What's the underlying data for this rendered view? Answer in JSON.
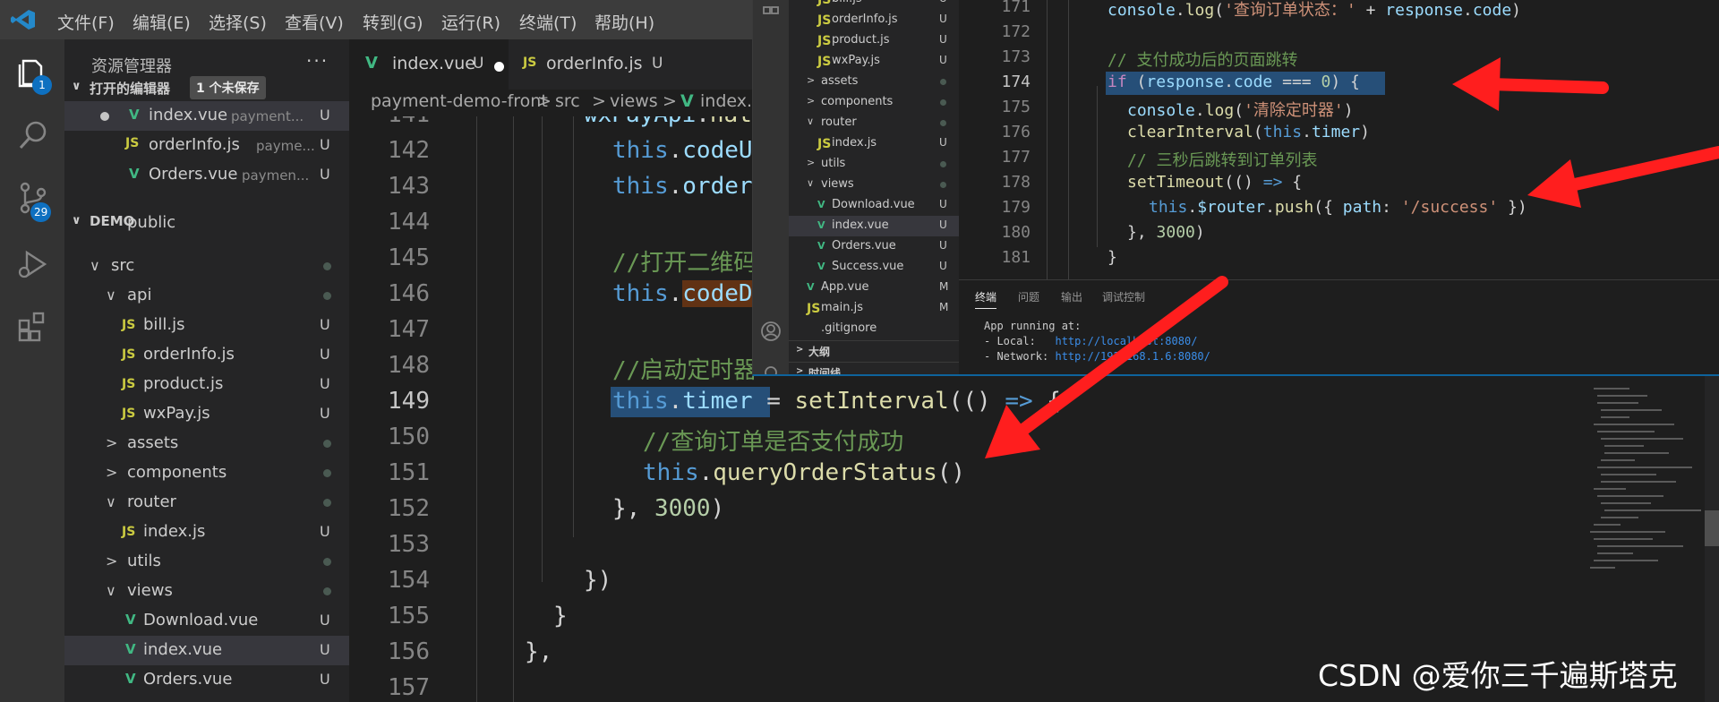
{
  "menubar": {
    "items": [
      "文件(F)",
      "编辑(E)",
      "选择(S)",
      "查看(V)",
      "转到(G)",
      "运行(R)",
      "终端(T)",
      "帮助(H)"
    ]
  },
  "activity": {
    "explorer_badge": "1",
    "scm_badge": "29"
  },
  "sidebar": {
    "title": "资源管理器",
    "more": "···",
    "open_editors": {
      "title": "打开的编辑器",
      "unsaved_badge": "1 个未保存",
      "items": [
        {
          "icon": "V",
          "name": "index.vue",
          "desc": "payment...",
          "status": "U"
        },
        {
          "icon": "JS",
          "name": "orderInfo.js",
          "desc": "payme...",
          "status": "U"
        },
        {
          "icon": "V",
          "name": "Orders.vue",
          "desc": "paymen...",
          "status": "U"
        }
      ]
    },
    "demo": {
      "title": "DEMO",
      "items": [
        {
          "chev": "",
          "icon": "",
          "name": "public",
          "status": ""
        },
        {
          "chev": "∨",
          "icon": "",
          "name": "src",
          "status": "dot"
        },
        {
          "chev": "∨",
          "icon": "",
          "name": "api",
          "status": "dot"
        },
        {
          "chev": "",
          "icon": "JS",
          "name": "bill.js",
          "status": "U"
        },
        {
          "chev": "",
          "icon": "JS",
          "name": "orderInfo.js",
          "status": "U"
        },
        {
          "chev": "",
          "icon": "JS",
          "name": "product.js",
          "status": "U"
        },
        {
          "chev": "",
          "icon": "JS",
          "name": "wxPay.js",
          "status": "U"
        },
        {
          "chev": ">",
          "icon": "",
          "name": "assets",
          "status": "dot"
        },
        {
          "chev": ">",
          "icon": "",
          "name": "components",
          "status": "dot"
        },
        {
          "chev": "∨",
          "icon": "",
          "name": "router",
          "status": "dot"
        },
        {
          "chev": "",
          "icon": "JS",
          "name": "index.js",
          "status": "U"
        },
        {
          "chev": ">",
          "icon": "",
          "name": "utils",
          "status": "dot"
        },
        {
          "chev": "∨",
          "icon": "",
          "name": "views",
          "status": "dot"
        },
        {
          "chev": "",
          "icon": "V",
          "name": "Download.vue",
          "status": "U"
        },
        {
          "chev": "",
          "icon": "V",
          "name": "index.vue",
          "status": "U"
        },
        {
          "chev": "",
          "icon": "V",
          "name": "Orders.vue",
          "status": "U"
        }
      ]
    }
  },
  "tabs": [
    {
      "icon": "V",
      "name": "index.vue",
      "status": "U"
    },
    {
      "icon": "JS",
      "name": "orderInfo.js",
      "status": "U"
    }
  ],
  "breadcrumb": [
    "payment-demo-front",
    ">",
    "src",
    ">",
    "views",
    ">",
    "index.vu"
  ],
  "editor": {
    "line_numbers": [
      "141",
      "142",
      "143",
      "144",
      "145",
      "146",
      "147",
      "148",
      "149",
      "150",
      "151",
      "152",
      "153",
      "154",
      "155",
      "156",
      "157"
    ],
    "current_line": "149"
  },
  "overlay": {
    "tree": [
      {
        "chev": "",
        "icon": "JS",
        "name": "bill.js",
        "status": "U"
      },
      {
        "chev": "",
        "icon": "JS",
        "name": "orderInfo.js",
        "status": "U"
      },
      {
        "chev": "",
        "icon": "JS",
        "name": "product.js",
        "status": "U"
      },
      {
        "chev": "",
        "icon": "JS",
        "name": "wxPay.js",
        "status": "U"
      },
      {
        "chev": ">",
        "icon": "",
        "name": "assets",
        "status": "dot"
      },
      {
        "chev": ">",
        "icon": "",
        "name": "components",
        "status": "dot"
      },
      {
        "chev": "∨",
        "icon": "",
        "name": "router",
        "status": "dot"
      },
      {
        "chev": "",
        "icon": "JS",
        "name": "index.js",
        "status": "U"
      },
      {
        "chev": ">",
        "icon": "",
        "name": "utils",
        "status": "dot"
      },
      {
        "chev": "∨",
        "icon": "",
        "name": "views",
        "status": "dot"
      },
      {
        "chev": "",
        "icon": "V",
        "name": "Download.vue",
        "status": "U"
      },
      {
        "chev": "",
        "icon": "V",
        "name": "index.vue",
        "status": "U"
      },
      {
        "chev": "",
        "icon": "V",
        "name": "Orders.vue",
        "status": "U"
      },
      {
        "chev": "",
        "icon": "V",
        "name": "Success.vue",
        "status": "U"
      },
      {
        "chev": "",
        "icon": "V",
        "name": "App.vue",
        "status": "M"
      },
      {
        "chev": "",
        "icon": "JS",
        "name": "main.js",
        "status": "M"
      },
      {
        "chev": "",
        "icon": "",
        "name": ".gitignore",
        "status": ""
      }
    ],
    "outline_label": "大纲",
    "timeline_label": "时间线",
    "line_numbers": [
      "171",
      "172",
      "173",
      "174",
      "175",
      "176",
      "177",
      "178",
      "179",
      "180",
      "181"
    ],
    "current_line": "174",
    "panel_tabs": [
      "终端",
      "问题",
      "输出",
      "调试控制"
    ],
    "terminal": {
      "line1": "App running at:",
      "local_label": "- Local:   ",
      "local_url": "http://localhost:8080/",
      "network_label": "- Network: ",
      "network_url": "http://192.168.1.6:8080/"
    }
  },
  "watermark": "CSDN @爱你三千遍斯塔克",
  "colors": {
    "arrow": "#ff1e1e",
    "vue": "#41b883",
    "js": "#cbcb41",
    "badge": "#0e70c0"
  }
}
